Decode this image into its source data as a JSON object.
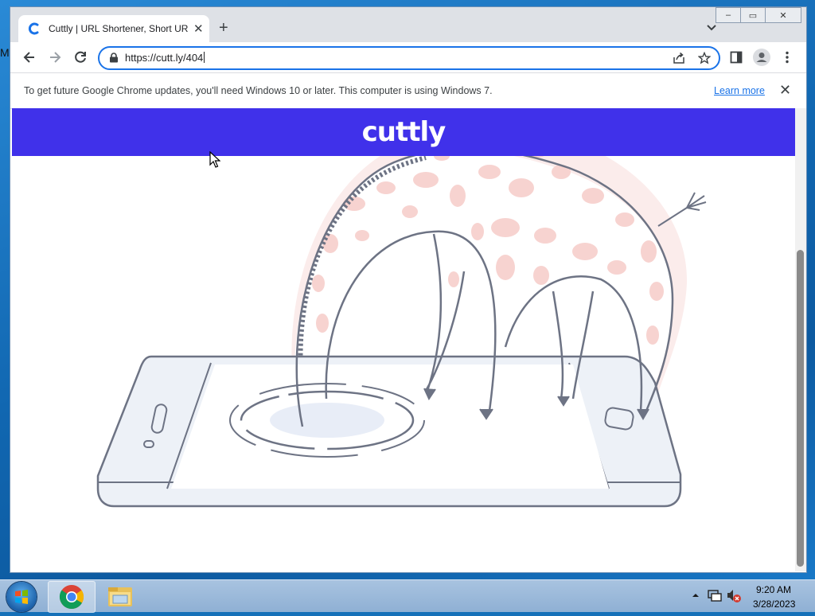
{
  "desktop": {
    "edge_letter": "M"
  },
  "browser": {
    "tab": {
      "title": "Cuttly | URL Shortener, Short URL",
      "close": "✕"
    },
    "new_tab": "+",
    "window_controls": {
      "minimize": "–",
      "maximize": "▭",
      "close": "✕"
    },
    "omnibox": {
      "url": "https://cutt.ly/404"
    },
    "infobar": {
      "message": "To get future Google Chrome updates, you'll need Windows 10 or later. This computer is using Windows 7.",
      "link": "Learn more",
      "close": "✕"
    },
    "accent_color": "#1a73e8"
  },
  "page": {
    "header_color": "#4031ea",
    "logo": "cuttly",
    "illustration": "giraffe-diving-into-phone-404"
  },
  "taskbar": {
    "apps": [
      "chrome-icon",
      "file-explorer-icon"
    ],
    "clock": {
      "time": "9:20 AM",
      "date": "3/28/2023"
    }
  }
}
